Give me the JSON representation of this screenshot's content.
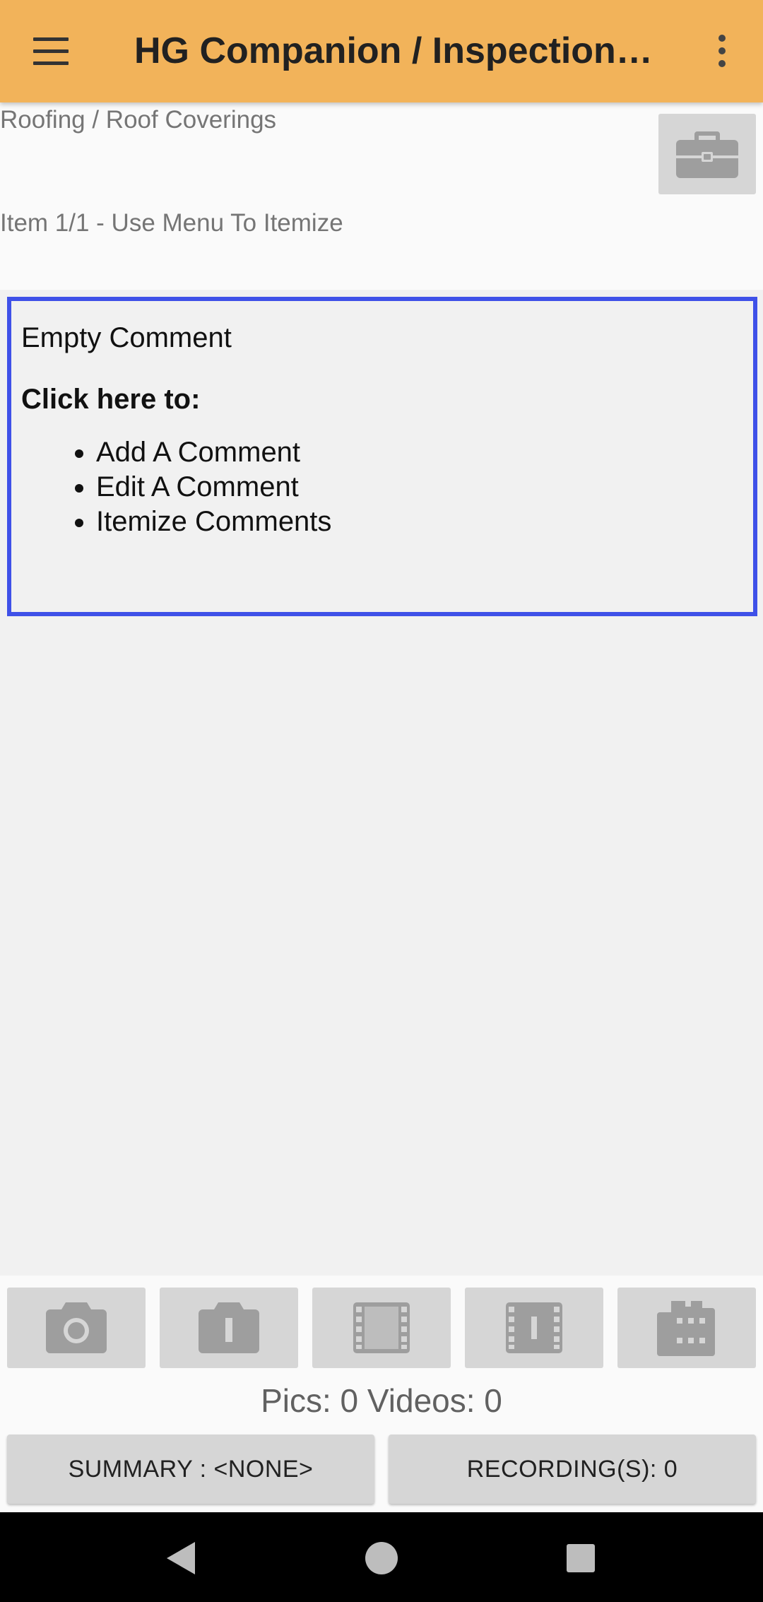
{
  "appbar": {
    "title": "HG Companion / Inspection It…",
    "color": "#f2b35a",
    "menu_icon": "hamburger-menu-icon",
    "overflow_icon": "more-vert-icon"
  },
  "breadcrumb": "Roofing / Roof Coverings",
  "item_label": "Item 1/1 - Use Menu To Itemize",
  "comment": {
    "empty_text": "Empty Comment",
    "cta": "Click here to:",
    "options": [
      "Add A Comment",
      "Edit A Comment",
      "Itemize Comments"
    ],
    "border_color": "#3f51e8"
  },
  "media_buttons": [
    {
      "icon": "camera-icon"
    },
    {
      "icon": "camera-alt-icon"
    },
    {
      "icon": "film-icon"
    },
    {
      "icon": "film-alt-icon"
    },
    {
      "icon": "film-roll-icon"
    }
  ],
  "counts": "Pics: 0 Videos: 0",
  "summary_button": "SUMMARY : <NONE>",
  "recordings_button": "RECORDING(S): 0",
  "navbar": {
    "back_icon": "back-triangle-icon",
    "home_icon": "home-circle-icon",
    "recents_icon": "recents-square-icon"
  }
}
